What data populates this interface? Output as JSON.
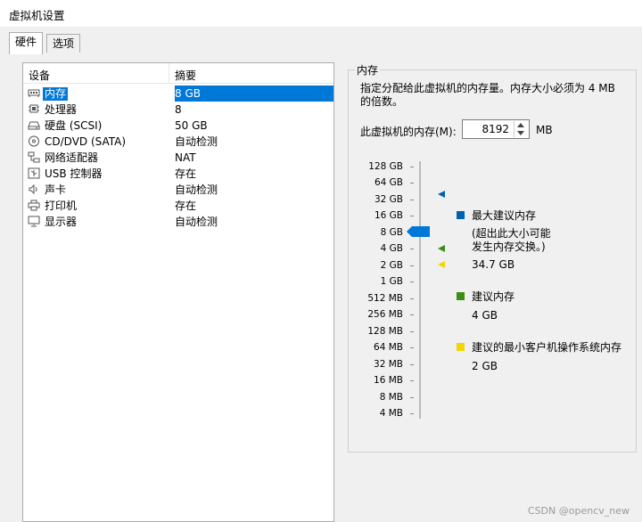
{
  "window": {
    "title": "虚拟机设置"
  },
  "tabs": [
    {
      "label": "硬件",
      "active": true
    },
    {
      "label": "选项",
      "active": false
    }
  ],
  "device_list": {
    "headers": {
      "device": "设备",
      "summary": "摘要"
    },
    "items": [
      {
        "name": "内存",
        "summary": "8 GB",
        "icon": "memory-icon",
        "selected": true
      },
      {
        "name": "处理器",
        "summary": "8",
        "icon": "processor-icon"
      },
      {
        "name": "硬盘 (SCSI)",
        "summary": "50 GB",
        "icon": "harddisk-icon"
      },
      {
        "name": "CD/DVD (SATA)",
        "summary": "自动检测",
        "icon": "cd-dvd-icon"
      },
      {
        "name": "网络适配器",
        "summary": "NAT",
        "icon": "network-adapter-icon"
      },
      {
        "name": "USB 控制器",
        "summary": "存在",
        "icon": "usb-icon"
      },
      {
        "name": "声卡",
        "summary": "自动检测",
        "icon": "sound-card-icon"
      },
      {
        "name": "打印机",
        "summary": "存在",
        "icon": "printer-icon"
      },
      {
        "name": "显示器",
        "summary": "自动检测",
        "icon": "display-icon"
      }
    ]
  },
  "memory_panel": {
    "title": "内存",
    "description": "指定分配给此虚拟机的内存量。内存大小必须为 4 MB 的倍数。",
    "input_label": "此虚拟机的内存(M):",
    "input_value": "8192",
    "unit": "MB",
    "scale_labels": [
      "128 GB",
      "64 GB",
      "32 GB",
      "16 GB",
      "8 GB",
      "4 GB",
      "2 GB",
      "1 GB",
      "512 MB",
      "256 MB",
      "128 MB",
      "64 MB",
      "32 MB",
      "16 MB",
      "8 MB",
      "4 MB"
    ],
    "current_value": "8 GB",
    "legend": {
      "max_label": "最大建议内存",
      "max_note_line1": "(超出此大小可能",
      "max_note_line2": "发生内存交换。)",
      "max_value": "34.7 GB",
      "recommended_label": "建议内存",
      "recommended_value": "4 GB",
      "min_label": "建议的最小客户机操作系统内存",
      "min_value": "2 GB"
    },
    "colors": {
      "max": "#0063b1",
      "recommended": "#3c8d14",
      "min": "#f2d600",
      "selection": "#0078d7"
    }
  },
  "watermark": "CSDN @opencv_new"
}
